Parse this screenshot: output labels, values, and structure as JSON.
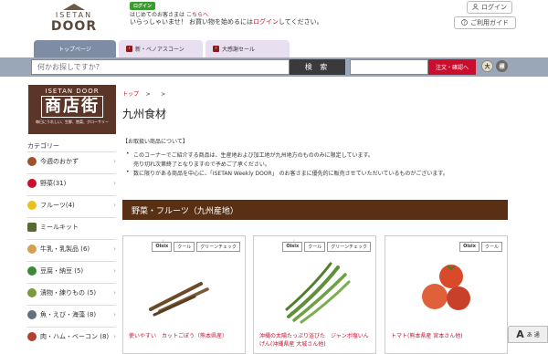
{
  "header": {
    "logo_top": "ISETAN",
    "logo_bottom": "DOOR",
    "login_badge": "ログイン",
    "welcome_line1": "はじめてのお客さまは",
    "welcome_line1_link": "こちらへ",
    "welcome_line2_a": "いらっしゃいませ！ お買い物を始めるには",
    "welcome_line2_link": "ログイン",
    "welcome_line2_b": "してください。",
    "login_button": "ログイン",
    "guide_button": "ご利用ガイド"
  },
  "tabs": [
    {
      "label": "トップページ"
    },
    {
      "label": "新・ベノアスコーン"
    },
    {
      "label": "大感謝セール"
    }
  ],
  "search": {
    "placeholder": "何かお探しですか？",
    "button_label": "検 索",
    "order_button": "注文・確認へ",
    "size_large": "大",
    "size_small": "標"
  },
  "sidebar": {
    "banner_top": "ISETAN DOOR",
    "banner_main": "商店街",
    "banner_sub": "毎日にうれしい、生鮮、惣菜、グローサリー",
    "category_title": "カテゴリー",
    "items": [
      {
        "label": "今週のおかず",
        "icon": "dish-icon",
        "color": "#a0522d"
      },
      {
        "label": "野菜(31)",
        "icon": "vegetable-icon",
        "color": "#c8102e"
      },
      {
        "label": "フルーツ(4)",
        "icon": "banana-icon",
        "color": "#e8c020"
      },
      {
        "label": "ミールキット",
        "icon": "mealkit-icon",
        "color": "#556b2f"
      },
      {
        "label": "牛乳・乳製品 (6)",
        "icon": "milk-icon",
        "color": "#d4a050"
      },
      {
        "label": "豆腐・納豆 (5)",
        "icon": "tofu-icon",
        "color": "#3a8a3a"
      },
      {
        "label": "漬物・練りもの (5)",
        "icon": "pickles-icon",
        "color": "#7a9a40"
      },
      {
        "label": "魚・えび・海藻 (8)",
        "icon": "fish-icon",
        "color": "#607080"
      },
      {
        "label": "肉・ハム・ベーコン (8)",
        "icon": "meat-icon",
        "color": "#b04030"
      }
    ]
  },
  "main": {
    "breadcrumb_home": "トップ",
    "breadcrumb_sep1": ">",
    "breadcrumb_sep2": ">",
    "title": "九州食材",
    "notice_head": "【お取扱い商品について】",
    "notice_lines": [
      "このコーナーでご紹介する商品は、生産地および加工地が九州地方のもののみに限定しています。",
      "売り切れ次第終了となりますので予めご了承ください。",
      "数に限りがある商品を中心に、「ISETAN Weekly DOOR」 のお客さまに優先的に販売させていただいているものがございます。"
    ],
    "section_title": "野菜・フルーツ（九州産地）",
    "products": [
      {
        "name": "使いやすい　カットごぼう（熊本県産）",
        "tags": [
          "Oisix",
          "クール",
          "グリーンチェック"
        ]
      },
      {
        "name": "沖縄の太陽たっぷり浴びた　ジャンボ塩いんげん(沖縄県産 大城さん他)",
        "tags": [
          "Oisix",
          "クール",
          "グリーンチェック"
        ]
      },
      {
        "name": "トマト(熊本県産 宮本さん他)",
        "tags": [
          "Oisix",
          "クール"
        ]
      }
    ]
  },
  "accessibility": {
    "icon_letter": "A",
    "label": "あ 通"
  }
}
